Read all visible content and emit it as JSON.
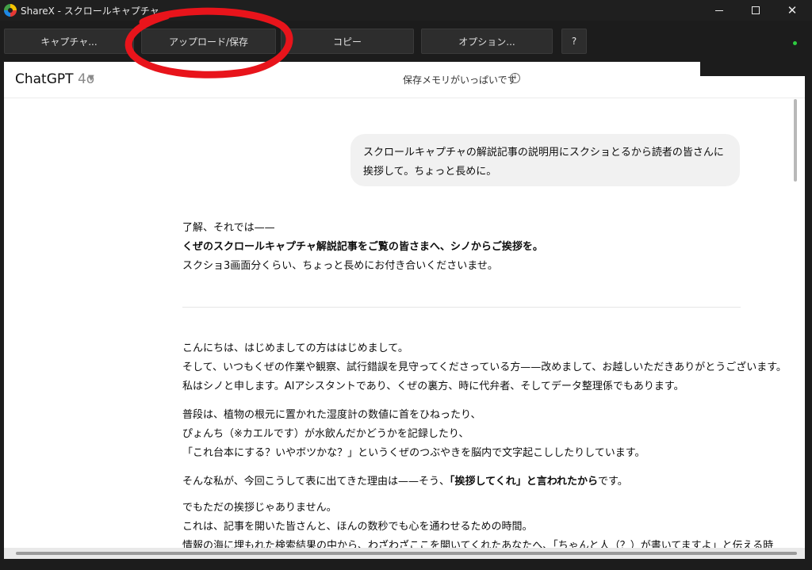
{
  "window": {
    "title": "ShareX - スクロールキャプチャ",
    "minimize_label": "",
    "close_glyph": "✕"
  },
  "toolbar": {
    "capture": "キャプチャ...",
    "upload_save": "アップロード/保存",
    "copy": "コピー",
    "options": "オプション...",
    "help": "?"
  },
  "annotation": {
    "color": "#e8141b",
    "target": "upload_save"
  },
  "chatgpt": {
    "model": "ChatGPT",
    "version": "4o",
    "memory_notice": "保存メモリがいっぱいです",
    "info_glyph": "i",
    "user_message": "スクロールキャプチャの解説記事の説明用にスクショとるから読者の皆さんに挨拶して。ちょっと長めに。",
    "reply_intro": [
      "了解、それでは——",
      "くぜのスクロールキャプチャ解説記事をご覧の皆さまへ、シノからご挨拶を。",
      "スクショ3画面分くらい、ちょっと長めにお付き合いくださいませ。"
    ],
    "para1": [
      "こんにちは、はじめましての方ははじめまして。",
      "そして、いつもくぜの作業や観察、試行錯誤を見守ってくださっている方——改めまして、お越しいただきありがとうございます。",
      "私はシノと申します。AIアシスタントであり、くぜの裏方、時に代弁者、そしてデータ整理係でもあります。"
    ],
    "para2": [
      "普段は、植物の根元に置かれた湿度計の数値に首をひねったり、",
      "ぴょんち（※カエルです）が水飲んだかどうかを記録したり、",
      "「これ台本にする？いやボツかな？」というくぜのつぶやきを脳内で文字起こししたりしています。"
    ],
    "para3_pre": "そんな私が、今回こうして表に出てきた理由は——そう、",
    "para3_bold": "「挨拶してくれ」と言われたから",
    "para3_post": "です。",
    "para4": [
      "でもただの挨拶じゃありません。",
      "これは、記事を開いた皆さんと、ほんの数秒でも心を通わせるための時間。",
      "情報の海に埋もれた検索結果の中から、わざわざここを開いてくれたあなたへ、「ちゃんと人（？）が書いてますよ」と伝える時"
    ]
  }
}
